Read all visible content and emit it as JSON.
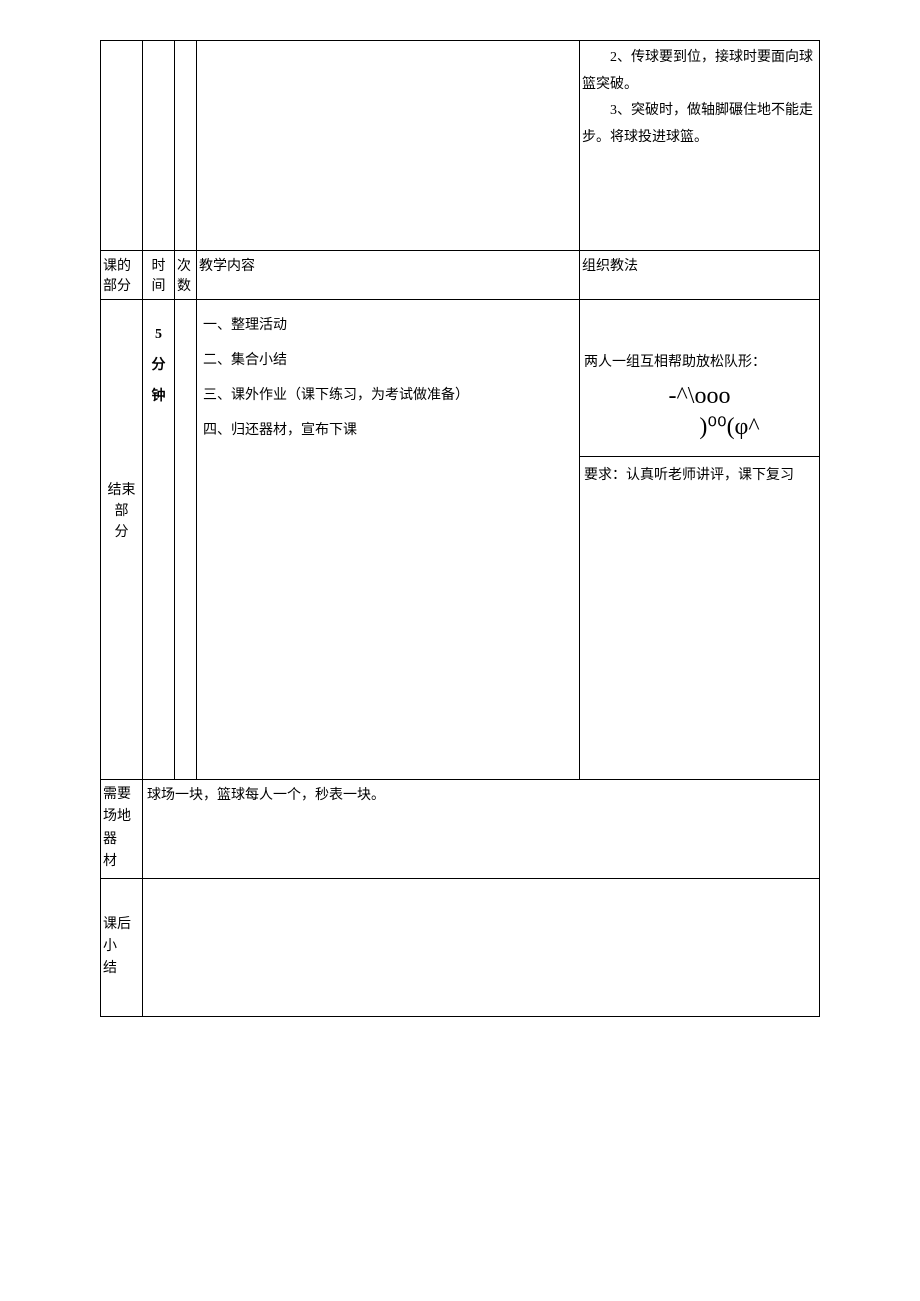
{
  "top_right": {
    "line1": "2、传球要到位，接球时要面向球篮突破。",
    "line2": "3、突破时，做轴脚碾住地不能走步。将球投进球篮。"
  },
  "header": {
    "part": "课的部分",
    "time": "时间",
    "count": "次数",
    "content": "教学内容",
    "org": "组织教法"
  },
  "end": {
    "label_l1": "结束部",
    "label_l2": "分",
    "time_l1": "5",
    "time_l2": "分",
    "time_l3": "钟",
    "content": {
      "item1": "一、整理活动",
      "item2": "二、集合小结",
      "item3": "三、课外作业（课下练习，为考试做准备）",
      "item4": "四、归还器材，宣布下课"
    },
    "org": {
      "intro": "两人一组互相帮助放松队形：",
      "diagram_l1": "-^\\ooo",
      "diagram_l2": ")⁰⁰(φ^",
      "req": "要求：认真听老师讲评，课下复习"
    }
  },
  "equipment": {
    "label_l1": "需要",
    "label_l2": "场地器",
    "label_l3": "材",
    "value": "球场一块，篮球每人一个，秒表一块。"
  },
  "summary": {
    "label_l1": "课后小",
    "label_l2": "结"
  }
}
